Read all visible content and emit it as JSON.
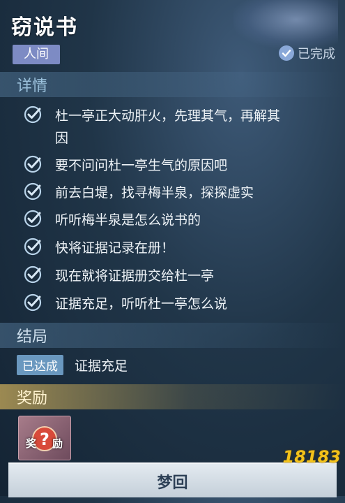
{
  "header": {
    "title": "窃说书",
    "tag": "人间",
    "status": "已完成"
  },
  "details": {
    "title": "详情",
    "tasks": [
      {
        "text": "杜一亭正大动肝火，先理其气，再解其",
        "text2": "因"
      },
      {
        "text": "要不问问杜一亭生气的原因吧"
      },
      {
        "text": "前去白堤，找寻梅半泉，探探虚实"
      },
      {
        "text": "听听梅半泉是怎么说书的"
      },
      {
        "text": "快将证据记录在册！"
      },
      {
        "text": "现在就将证据册交给杜一亭"
      },
      {
        "text": "证据充足，听听杜一亭怎么说"
      }
    ]
  },
  "ending": {
    "title": "结局",
    "badge": "已达成",
    "text": "证据充足"
  },
  "reward": {
    "title": "奖励",
    "item_left": "奖",
    "item_right": "励"
  },
  "footer": {
    "button": "梦回"
  },
  "watermark": "18183",
  "colors": {
    "tag_bg": "#7d8bc4",
    "check": "#b9d4ea",
    "reward_gold": "#c8aa5a"
  },
  "icons": {
    "task": "check-icon",
    "status": "check-circle-icon",
    "reward": "question-mark-icon"
  }
}
